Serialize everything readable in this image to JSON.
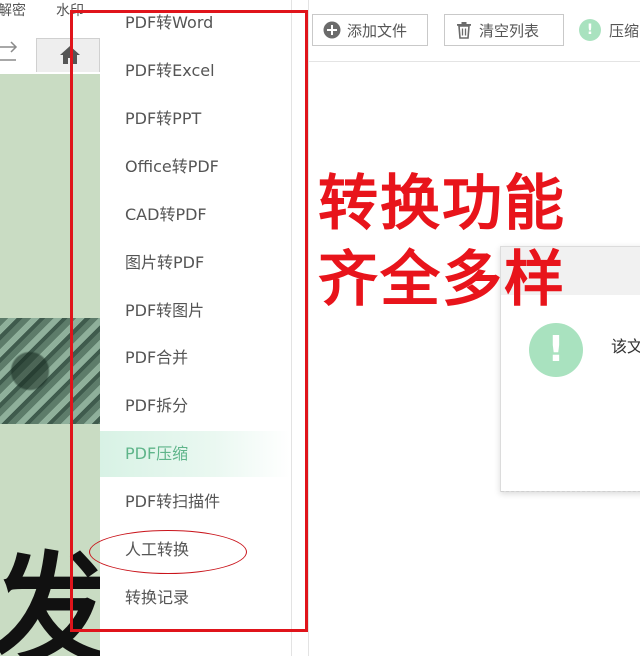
{
  "top_tabs": {
    "decrypt": "解密",
    "watermark": "水印"
  },
  "menu": {
    "items": [
      {
        "label": "PDF转Word",
        "active": false
      },
      {
        "label": "PDF转Excel",
        "active": false
      },
      {
        "label": "PDF转PPT",
        "active": false
      },
      {
        "label": "Office转PDF",
        "active": false
      },
      {
        "label": "CAD转PDF",
        "active": false
      },
      {
        "label": "图片转PDF",
        "active": false
      },
      {
        "label": "PDF转图片",
        "active": false
      },
      {
        "label": "PDF合并",
        "active": false
      },
      {
        "label": "PDF拆分",
        "active": false
      },
      {
        "label": "PDF压缩",
        "active": true
      },
      {
        "label": "PDF转扫描件",
        "active": false
      },
      {
        "label": "人工转换",
        "active": false
      },
      {
        "label": "转换记录",
        "active": false
      }
    ]
  },
  "toolbar": {
    "add_file": "添加文件",
    "clear_list": "清空列表",
    "compress": "压缩"
  },
  "headline": {
    "line1": "转换功能",
    "line2": "齐全多样"
  },
  "dialog": {
    "icon": "!",
    "text": "该文"
  },
  "left_image": {
    "big_char": "发"
  },
  "colors": {
    "accent_green": "#5fb58a",
    "annotation_red": "#e0141b",
    "active_bg": "#d8f2e5"
  }
}
